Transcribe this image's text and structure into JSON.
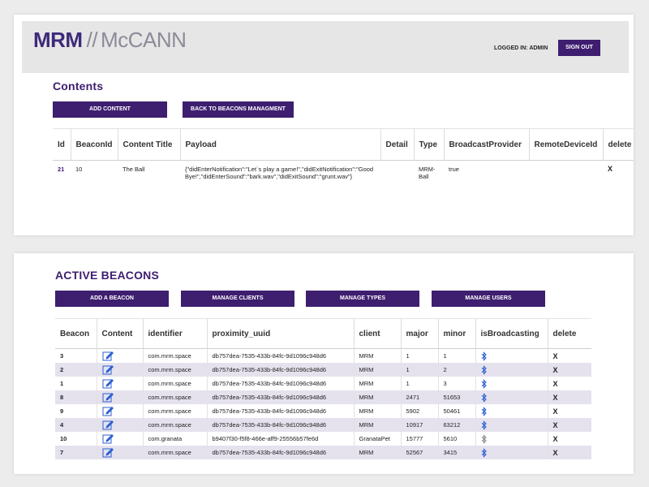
{
  "brand": {
    "logo_primary": "MRM",
    "logo_separator": "//",
    "logo_secondary": "McCANN"
  },
  "header": {
    "logged_in_label": "LOGGED IN:",
    "logged_in_user": "ADMIN",
    "sign_out": "SIGN OUT"
  },
  "contents": {
    "title": "Contents",
    "buttons": {
      "add_content": "ADD CONTENT",
      "back": "BACK TO BEACONS MANAGMENT"
    },
    "columns": [
      "Id",
      "BeaconId",
      "Content Title",
      "Payload",
      "Detail",
      "Type",
      "BroadcastProvider",
      "RemoteDeviceId",
      "delete"
    ],
    "rows": [
      {
        "id": "21",
        "beacon_id": "10",
        "content_title": "The Ball",
        "payload": "{\"didEnterNotification\":\"Let`s play a game!\",\"didExitNotification\":\"Good Bye!\",\"didEnterSound\":\"bark.wav\",\"didExitSound\":\"grunt.wav\"}",
        "detail": "",
        "type": "MRM-Ball",
        "broadcast_provider": "true",
        "remote_device_id": "",
        "delete": "X"
      }
    ]
  },
  "beacons": {
    "title": "ACTIVE BEACONS",
    "buttons": {
      "add_beacon": "ADD A BEACON",
      "manage_clients": "MANAGE CLIENTS",
      "manage_types": "MANAGE TYPES",
      "manage_users": "MANAGE USERS"
    },
    "columns": [
      "Beacon",
      "Content",
      "identifier",
      "proximity_uuid",
      "client",
      "major",
      "minor",
      "isBroadcasting",
      "delete"
    ],
    "rows": [
      {
        "beacon": "3",
        "identifier": "com.mrm.space",
        "uuid": "db757dea-7535-433b-84fc-9d1096c948d6",
        "client": "MRM",
        "major": "1",
        "minor": "1",
        "broadcasting": true,
        "delete": "X"
      },
      {
        "beacon": "2",
        "identifier": "com.mrm.space",
        "uuid": "db757dea-7535-433b-84fc-9d1096c948d6",
        "client": "MRM",
        "major": "1",
        "minor": "2",
        "broadcasting": true,
        "delete": "X"
      },
      {
        "beacon": "1",
        "identifier": "com.mrm.space",
        "uuid": "db757dea-7535-433b-84fc-9d1096c948d6",
        "client": "MRM",
        "major": "1",
        "minor": "3",
        "broadcasting": true,
        "delete": "X"
      },
      {
        "beacon": "8",
        "identifier": "com.mrm.space",
        "uuid": "db757dea-7535-433b-84fc-9d1096c948d6",
        "client": "MRM",
        "major": "2471",
        "minor": "51653",
        "broadcasting": true,
        "delete": "X"
      },
      {
        "beacon": "9",
        "identifier": "com.mrm.space",
        "uuid": "db757dea-7535-433b-84fc-9d1096c948d6",
        "client": "MRM",
        "major": "5902",
        "minor": "50461",
        "broadcasting": true,
        "delete": "X"
      },
      {
        "beacon": "4",
        "identifier": "com.mrm.space",
        "uuid": "db757dea-7535-433b-84fc-9d1096c948d6",
        "client": "MRM",
        "major": "10917",
        "minor": "63212",
        "broadcasting": true,
        "delete": "X"
      },
      {
        "beacon": "10",
        "identifier": "com.granata",
        "uuid": "b9407f30-f5f8-466e-aff9-25556b57fe6d",
        "client": "GranataPet",
        "major": "15777",
        "minor": "5610",
        "broadcasting": false,
        "delete": "X"
      },
      {
        "beacon": "7",
        "identifier": "com.mrm.space",
        "uuid": "db757dea-7535-433b-84fc-9d1096c948d6",
        "client": "MRM",
        "major": "52567",
        "minor": "3415",
        "broadcasting": true,
        "delete": "X"
      }
    ]
  },
  "colors": {
    "accent": "#3e1e6f",
    "row_alt": "#e5e2ee",
    "bluetooth_on": "#2c5fd0",
    "bluetooth_off": "#8a8a8a"
  },
  "icons": {
    "content": "edit-icon",
    "broadcasting": "bluetooth-icon"
  }
}
